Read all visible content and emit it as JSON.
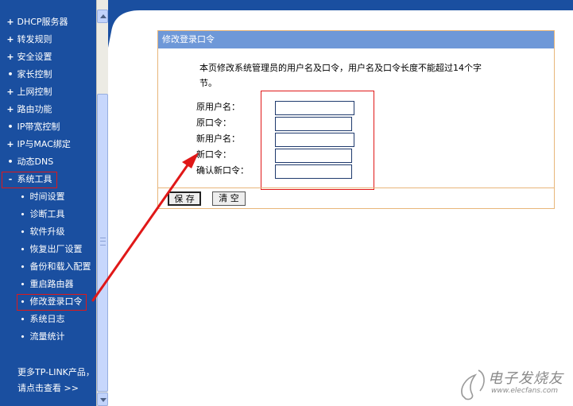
{
  "sidebar": {
    "items": [
      {
        "label": "DHCP服务器",
        "marker": "+"
      },
      {
        "label": "转发规则",
        "marker": "+"
      },
      {
        "label": "安全设置",
        "marker": "+"
      },
      {
        "label": "家长控制",
        "marker": "•"
      },
      {
        "label": "上网控制",
        "marker": "+"
      },
      {
        "label": "路由功能",
        "marker": "+"
      },
      {
        "label": "IP带宽控制",
        "marker": "•"
      },
      {
        "label": "IP与MAC绑定",
        "marker": "+"
      },
      {
        "label": "动态DNS",
        "marker": "•"
      },
      {
        "label": "系统工具",
        "marker": "-"
      }
    ],
    "sub_items": [
      {
        "label": "时间设置",
        "marker": "•"
      },
      {
        "label": "诊断工具",
        "marker": "•"
      },
      {
        "label": "软件升级",
        "marker": "•"
      },
      {
        "label": "恢复出厂设置",
        "marker": "•"
      },
      {
        "label": "备份和载入配置",
        "marker": "•"
      },
      {
        "label": "重启路由器",
        "marker": "•"
      },
      {
        "label": "修改登录口令",
        "marker": "•"
      },
      {
        "label": "系统日志",
        "marker": "•"
      },
      {
        "label": "流量统计",
        "marker": "•"
      }
    ],
    "more_line1": "更多TP-LINK产品，",
    "more_line2": "请点击查看 >>"
  },
  "panel": {
    "title": "修改登录口令",
    "intro_line1": "本页修改系统管理员的用户名及口令，用户名及口令长度不能超过14个字",
    "intro_line2": "节。",
    "fields": [
      {
        "label": "原用户名：",
        "value": ""
      },
      {
        "label": "原口令：",
        "value": ""
      },
      {
        "label": "新用户名：",
        "value": ""
      },
      {
        "label": "新口令：",
        "value": ""
      },
      {
        "label": "确认新口令：",
        "value": ""
      }
    ],
    "save_label": "保 存",
    "clear_label": "清 空"
  },
  "watermark": {
    "text": "电子发烧友",
    "url": "www.elecfans.com"
  },
  "colors": {
    "sidebar_bg": "#1a4fa0",
    "panel_header_bg": "#6e98d8",
    "panel_border": "#e8b67a",
    "highlight_red": "#e01818"
  }
}
